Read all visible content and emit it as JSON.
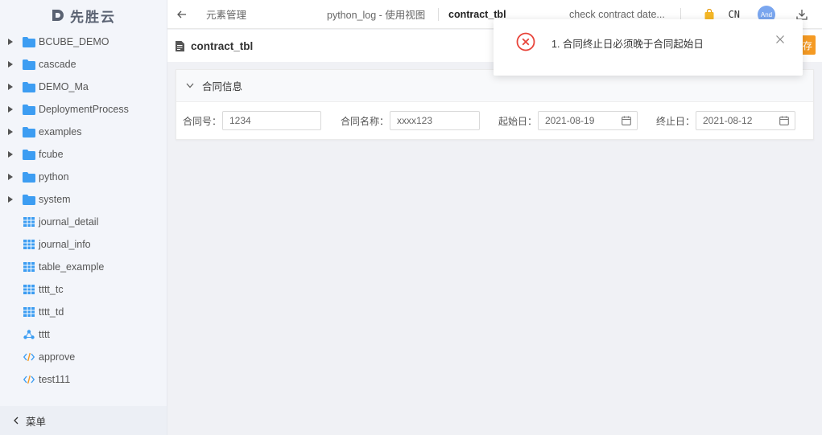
{
  "app": {
    "logo_text": "先胜云"
  },
  "sidebar": {
    "items": [
      {
        "label": "BCUBE_DEMO",
        "icon": "folder-icon",
        "expandable": true
      },
      {
        "label": "cascade",
        "icon": "folder-icon",
        "expandable": true
      },
      {
        "label": "DEMO_Ma",
        "icon": "folder-icon",
        "expandable": true
      },
      {
        "label": "DeploymentProcess",
        "icon": "folder-icon",
        "expandable": true
      },
      {
        "label": "examples",
        "icon": "folder-icon",
        "expandable": true
      },
      {
        "label": "fcube",
        "icon": "folder-icon",
        "expandable": true
      },
      {
        "label": "python",
        "icon": "folder-icon",
        "expandable": true
      },
      {
        "label": "system",
        "icon": "folder-icon",
        "expandable": true
      },
      {
        "label": "journal_detail",
        "icon": "table-icon",
        "expandable": false
      },
      {
        "label": "journal_info",
        "icon": "table-icon",
        "expandable": false
      },
      {
        "label": "table_example",
        "icon": "table-icon",
        "expandable": false
      },
      {
        "label": "tttt_tc",
        "icon": "table-icon",
        "expandable": false
      },
      {
        "label": "tttt_td",
        "icon": "table-icon",
        "expandable": false
      },
      {
        "label": "tttt",
        "icon": "flow-icon",
        "expandable": false
      },
      {
        "label": "approve",
        "icon": "code-icon",
        "expandable": false
      },
      {
        "label": "test111",
        "icon": "code-icon",
        "expandable": false
      }
    ],
    "footer_label": "菜单"
  },
  "topbar": {
    "tabs": [
      {
        "label": "元素管理"
      },
      {
        "label": "python_log - 使用视图"
      },
      {
        "label": "contract_tbl"
      },
      {
        "label": "check contract date..."
      }
    ],
    "lang": "CN",
    "avatar_text": "And"
  },
  "page": {
    "title": "contract_tbl",
    "save_label": "存"
  },
  "form": {
    "section_title": "合同信息",
    "fields": [
      {
        "label": "合同号：",
        "value": "1234"
      },
      {
        "label": "合同名称：",
        "value": "xxxx123"
      },
      {
        "label": "起始日：",
        "value": "2021-08-19"
      },
      {
        "label": "终止日：",
        "value": "2021-08-12"
      }
    ]
  },
  "toast": {
    "message": "1. 合同终止日必须晚于合同起始日"
  },
  "colors": {
    "folder": "#3d9df2",
    "accent_orange": "#f59a23",
    "error_red": "#e8443a",
    "avatar_blue": "#7aa6ef"
  }
}
